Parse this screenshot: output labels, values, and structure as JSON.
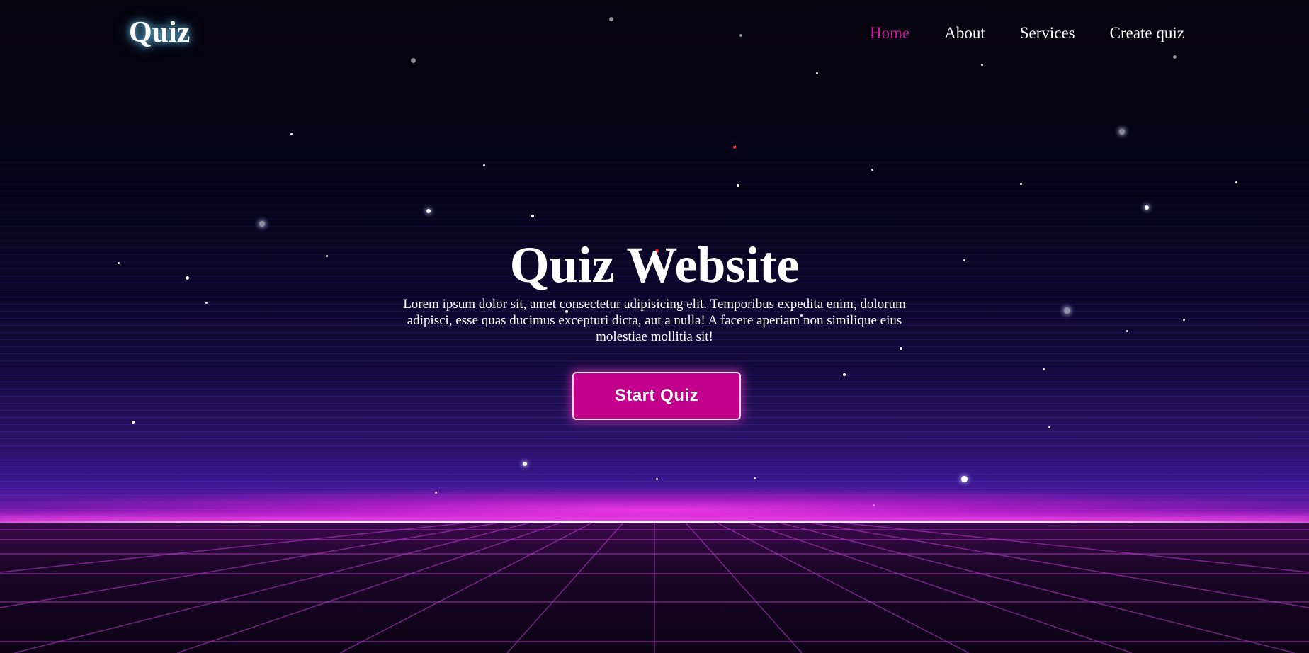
{
  "header": {
    "logo": "Quiz",
    "nav": [
      {
        "label": "Home",
        "active": true
      },
      {
        "label": "About",
        "active": false
      },
      {
        "label": "Services",
        "active": false
      },
      {
        "label": "Create quiz",
        "active": false
      }
    ]
  },
  "hero": {
    "title": "Quiz Website",
    "description": "Lorem ipsum dolor sit, amet consectetur adipisicing elit. Temporibus expedita enim, dolorum adipisci, esse quas ducimus excepturi dicta, aut a nulla! A facere aperiam non similique eius molestiae mollitia sit!",
    "button_label": "Start Quiz"
  },
  "colors": {
    "accent": "#c2008c",
    "active_nav": "#c8189c",
    "horizon_glow": "#ff3cf0",
    "logo_glow": "#78dcff"
  }
}
